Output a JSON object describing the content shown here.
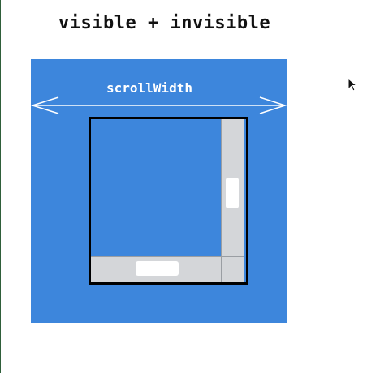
{
  "diagram": {
    "title": "visible + invisible",
    "dimension_label": "scrollWidth"
  },
  "colors": {
    "content_blue": "#3d86dc",
    "viewport_border": "#000000",
    "scrollbar_track": "#d4d6d9",
    "scrollbar_thumb": "#ffffff",
    "arrow": "#ffffff"
  },
  "icons": {
    "cursor": "mouse-pointer-icon"
  }
}
